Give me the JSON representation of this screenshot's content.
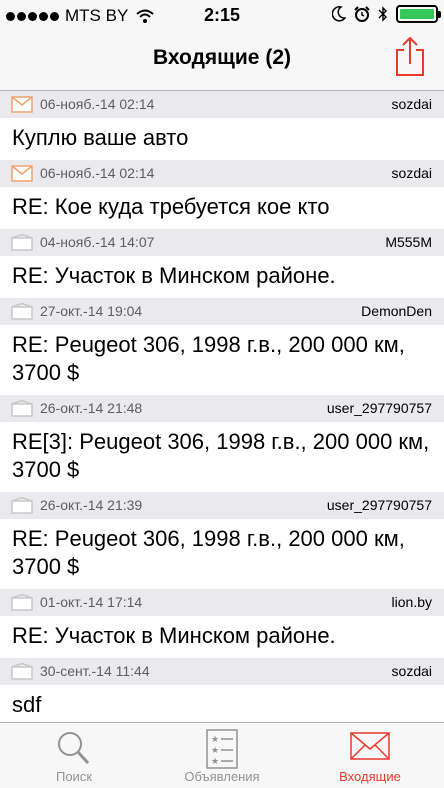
{
  "status": {
    "carrier": "MTS BY",
    "time": "2:15"
  },
  "nav": {
    "title": "Входящие (2)"
  },
  "colors": {
    "accent": "#e8392b",
    "unread_envelope": "#f2a16c",
    "read_envelope": "#c8c8c8"
  },
  "messages": [
    {
      "date": "06-нояб.-14 02:14",
      "author": "sozdai",
      "subject": "Куплю ваше авто",
      "unread": true
    },
    {
      "date": "06-нояб.-14 02:14",
      "author": "sozdai",
      "subject": "RE: Кое куда требуется кое кто",
      "unread": true
    },
    {
      "date": "04-нояб.-14 14:07",
      "author": "M555M",
      "subject": "RE: Участок в Минском районе.",
      "unread": false
    },
    {
      "date": "27-окт.-14 19:04",
      "author": "DemonDen",
      "subject": "RE: Peugeot 306, 1998 г.в., 200 000 км, 3700 $",
      "unread": false
    },
    {
      "date": "26-окт.-14 21:48",
      "author": "user_297790757",
      "subject": "RE[3]: Peugeot 306, 1998 г.в., 200 000 км, 3700 $",
      "unread": false
    },
    {
      "date": "26-окт.-14 21:39",
      "author": "user_297790757",
      "subject": "RE: Peugeot 306, 1998 г.в., 200 000 км, 3700 $",
      "unread": false
    },
    {
      "date": "01-окт.-14 17:14",
      "author": "lion.by",
      "subject": "RE: Участок в Минском районе.",
      "unread": false
    },
    {
      "date": "30-сент.-14 11:44",
      "author": "sozdai",
      "subject": "sdf",
      "unread": false
    }
  ],
  "tabs": [
    {
      "label": "Поиск",
      "icon": "search-icon"
    },
    {
      "label": "Объявления",
      "icon": "listings-icon"
    },
    {
      "label": "Входящие",
      "icon": "mail-icon",
      "active": true
    }
  ]
}
